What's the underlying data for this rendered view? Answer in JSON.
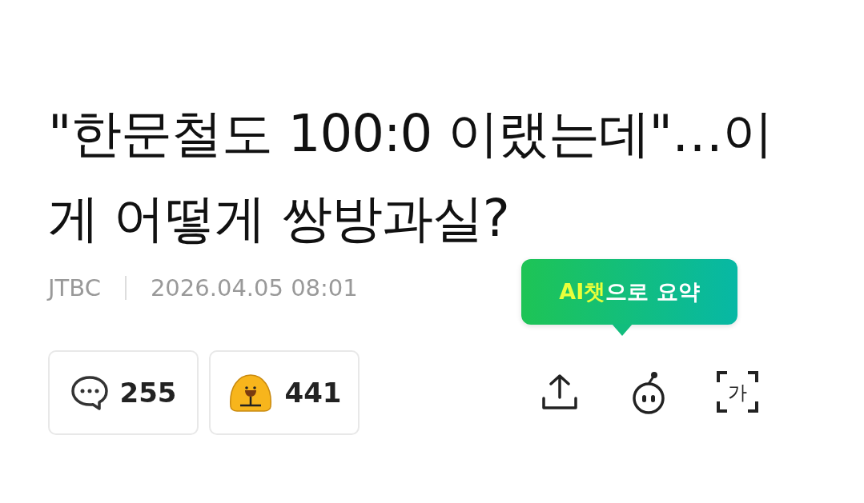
{
  "headline": "\"한문철도 100:0 이랬는데\"…이게 어떻게 쌍방과실?",
  "meta": {
    "source": "JTBC",
    "datetime": "2026.04.05 08:01"
  },
  "tooltip": {
    "highlight": "AI챗",
    "text": "으로 요약"
  },
  "reactions": [
    {
      "kind": "comment",
      "count": "255"
    },
    {
      "kind": "like",
      "count": "441"
    }
  ],
  "actions": [
    {
      "kind": "share"
    },
    {
      "kind": "ai_chat"
    },
    {
      "kind": "translate",
      "glyph": "가"
    }
  ]
}
